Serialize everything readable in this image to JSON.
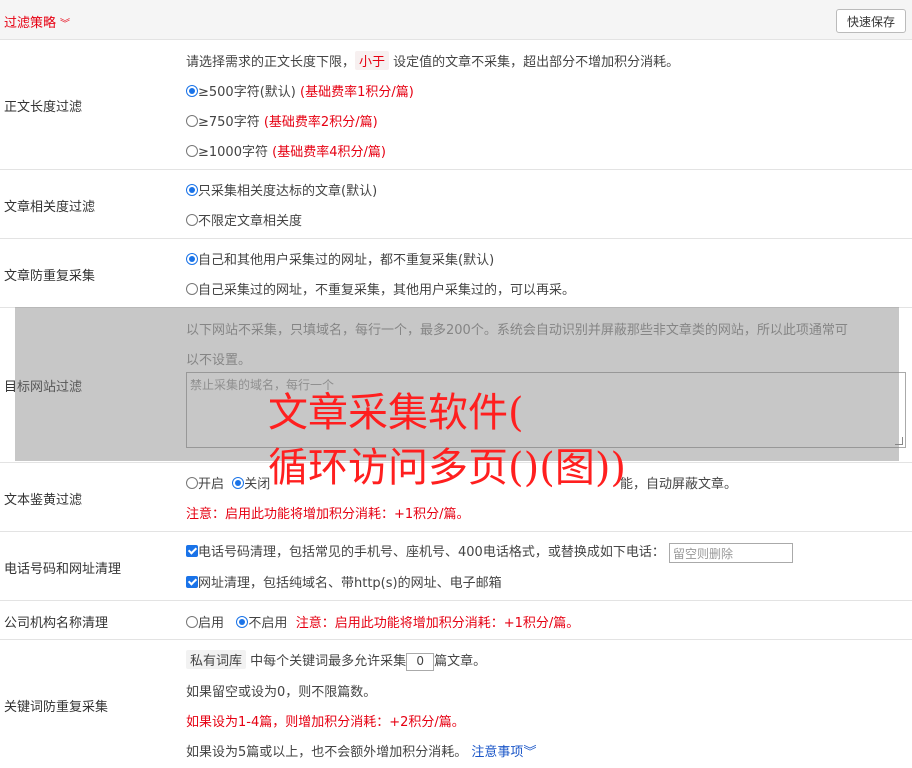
{
  "header": {
    "title": "过滤策略",
    "title_icon": "chevron-double-down-icon",
    "quick_save": "快速保存"
  },
  "length_filter": {
    "label": "正文长度过滤",
    "desc_before": "请选择需求的正文长度下限，",
    "desc_tag": "小于",
    "desc_after": "设定值的文章不采集，超出部分不增加积分消耗。",
    "options": [
      {
        "text": "≥500字符(默认)",
        "note": "(基础费率1积分/篇)",
        "selected": true
      },
      {
        "text": "≥750字符",
        "note": "(基础费率2积分/篇)",
        "selected": false
      },
      {
        "text": "≥1000字符",
        "note": "(基础费率4积分/篇)",
        "selected": false
      }
    ]
  },
  "relevance_filter": {
    "label": "文章相关度过滤",
    "options": [
      {
        "text": "只采集相关度达标的文章(默认)",
        "selected": true
      },
      {
        "text": "不限定文章相关度",
        "selected": false
      }
    ]
  },
  "duplicate_filter": {
    "label": "文章防重复采集",
    "options": [
      {
        "text": "自己和其他用户采集过的网址，都不重复采集(默认)",
        "selected": true
      },
      {
        "text": "自己采集过的网址，不重复采集，其他用户采集过的，可以再采。",
        "selected": false
      }
    ]
  },
  "site_filter": {
    "label": "目标网站过滤",
    "desc_line1": "以下网站不采集，只填域名，每行一个，最多200个。系统会自动识别并屏蔽那些非文章类的网站，所以此项通常可",
    "desc_line2": "以不设置。",
    "placeholder": "禁止采集的域名，每行一个"
  },
  "watermark": {
    "line1": "文章采集软件(",
    "line2": "循环访问多页()(图))"
  },
  "porn_filter": {
    "label": "文本鉴黄过滤",
    "opt_on": "开启",
    "opt_off_visible": "关闭",
    "tail": "能，自动屏蔽文章。",
    "off_selected": true,
    "notice": "注意：启用此功能将增加积分消耗：+1积分/篇。"
  },
  "phone_url_clean": {
    "label": "电话号码和网址清理",
    "phone_text": "电话号码清理，包括常见的手机号、座机号、400电话格式，或替换成如下电话：",
    "phone_placeholder": "留空则删除",
    "url_text": "网址清理，包括纯域名、带http(s)的网址、电子邮箱"
  },
  "company_clean": {
    "label": "公司机构名称清理",
    "opt_on": "启用",
    "opt_off": "不启用",
    "off_selected": true,
    "notice": "注意：启用此功能将增加积分消耗：+1积分/篇。"
  },
  "keyword_dup": {
    "label": "关键词防重复采集",
    "tag": "私有词库",
    "text_before": "中每个关键词最多允许采集",
    "value": "0",
    "text_after": "篇文章。",
    "line2": "如果留空或设为0，则不限篇数。",
    "line3": "如果设为1-4篇，则增加积分消耗：+2积分/篇。",
    "line4": "如果设为5篇或以上，也不会额外增加积分消耗。",
    "link": "注意事项",
    "link_icon": "chevron-double-down-icon"
  },
  "colors": {
    "accent": "#e60012",
    "link": "#1a56c8",
    "radio": "#1a73e8"
  }
}
